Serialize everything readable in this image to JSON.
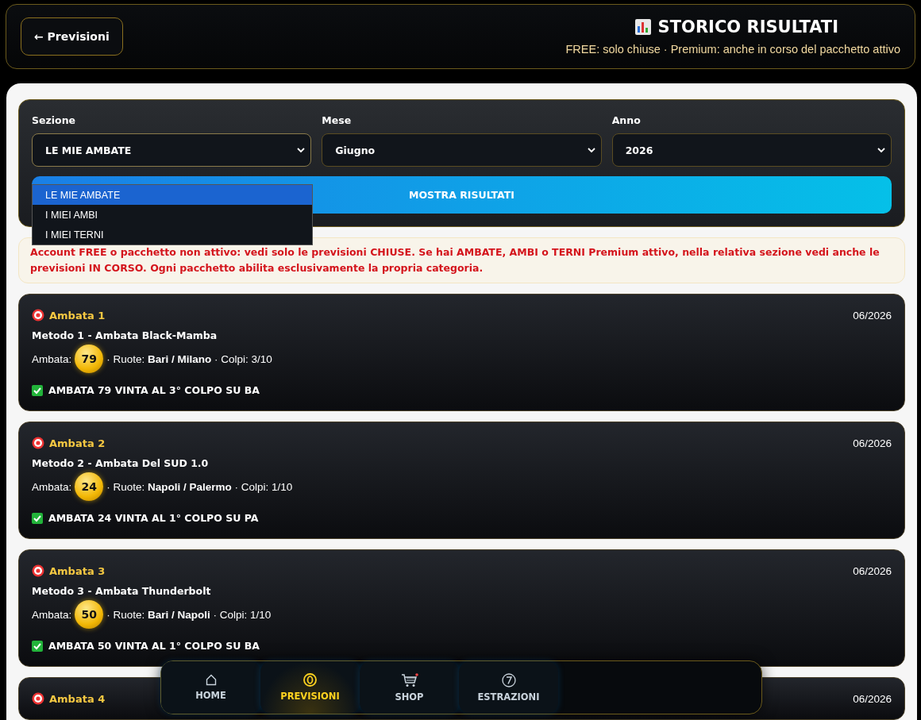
{
  "header": {
    "back_button": "← Previsioni",
    "title": "STORICO RISULTATI",
    "subtitle": "FREE: solo chiuse · Premium: anche in corso del pacchetto attivo"
  },
  "filters": {
    "fields": [
      {
        "label": "Sezione",
        "value": "LE MIE AMBATE",
        "expanded": true
      },
      {
        "label": "Mese",
        "value": "Giugno",
        "expanded": false
      },
      {
        "label": "Anno",
        "value": "2026",
        "expanded": false
      }
    ],
    "options": [
      {
        "label": "LE MIE AMBATE",
        "selected": true
      },
      {
        "label": "I MIEI AMBI",
        "selected": false
      },
      {
        "label": "I MIEI TERNI",
        "selected": false
      }
    ],
    "submit": "MOSTRA RISULTATI"
  },
  "notice": "Account FREE o pacchetto non attivo: vedi solo le previsioni CHIUSE. Se hai AMBATE, AMBI o TERNI Premium attivo, nella relativa sezione vedi anche le previsioni IN CORSO. Ogni pacchetto abilita esclusivamente la propria categoria.",
  "results": [
    {
      "title": "Ambata 1",
      "date": "06/2026",
      "method": "Metodo 1 - Ambata Black-Mamba",
      "ambata_label": "Ambata:",
      "number": "79",
      "details": "· Ruote: **Bari / Milano** · Colpi: 3/10",
      "outcome": "AMBATA 79 VINTA AL 3° COLPO SU BA",
      "won": true
    },
    {
      "title": "Ambata 2",
      "date": "06/2026",
      "method": "Metodo 2 - Ambata Del SUD 1.0",
      "ambata_label": "Ambata:",
      "number": "24",
      "details": "· Ruote: **Napoli / Palermo** · Colpi: 1/10",
      "outcome": "AMBATA 24 VINTA AL 1° COLPO SU PA",
      "won": true
    },
    {
      "title": "Ambata 3",
      "date": "06/2026",
      "method": "Metodo 3 - Ambata Thunderbolt",
      "ambata_label": "Ambata:",
      "number": "50",
      "details": "· Ruote: **Bari / Napoli** · Colpi: 1/10",
      "outcome": "AMBATA 50 VINTA AL 1° COLPO SU BA",
      "won": true
    },
    {
      "title": "Ambata 4",
      "date": "06/2026"
    }
  ],
  "bottom_nav": [
    {
      "kind": "home",
      "label": "HOME",
      "selected": false
    },
    {
      "kind": "predictions",
      "label": "PREVISIONI",
      "selected": true
    },
    {
      "kind": "shop",
      "label": "SHOP",
      "selected": false
    },
    {
      "kind": "draws",
      "label": "ESTRAZIONI",
      "selected": false
    }
  ]
}
